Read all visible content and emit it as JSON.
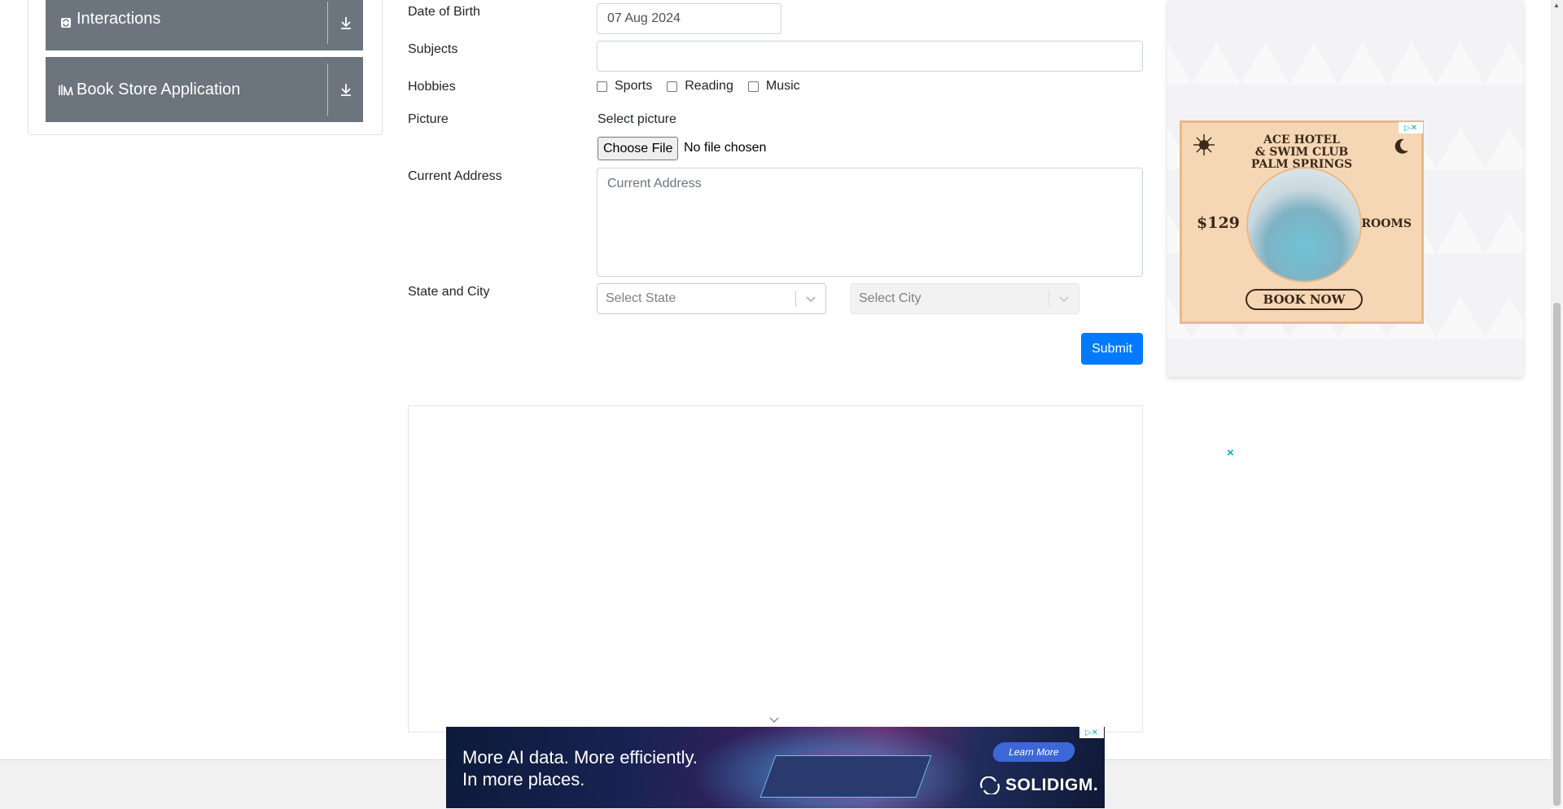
{
  "sidebar": {
    "groups": [
      {
        "label": "Interactions",
        "icon": "interactions-icon"
      },
      {
        "label": "Book Store Application",
        "icon": "book-store-icon"
      }
    ]
  },
  "form": {
    "dob": {
      "label": "Date of Birth",
      "value": "07 Aug 2024"
    },
    "subjects": {
      "label": "Subjects",
      "value": ""
    },
    "hobbies": {
      "label": "Hobbies",
      "options": [
        "Sports",
        "Reading",
        "Music"
      ]
    },
    "picture": {
      "label": "Picture",
      "select_text": "Select picture",
      "button": "Choose File",
      "status": "No file chosen"
    },
    "address": {
      "label": "Current Address",
      "placeholder": "Current Address"
    },
    "state_city": {
      "label": "State and City",
      "state_placeholder": "Select State",
      "city_placeholder": "Select City"
    },
    "submit": "Submit"
  },
  "ads": {
    "hotel": {
      "title_lines": [
        "ACE HOTEL",
        "& SWIM CLUB",
        "PALM SPRINGS"
      ],
      "price": "$129",
      "rooms": "ROOMS",
      "cta": "BOOK NOW"
    },
    "bottom": {
      "line1": "More AI data. More efficiently.",
      "line2": "In more places.",
      "cta": "Learn More",
      "brand": "SOLIDIGM."
    },
    "close": "×"
  }
}
